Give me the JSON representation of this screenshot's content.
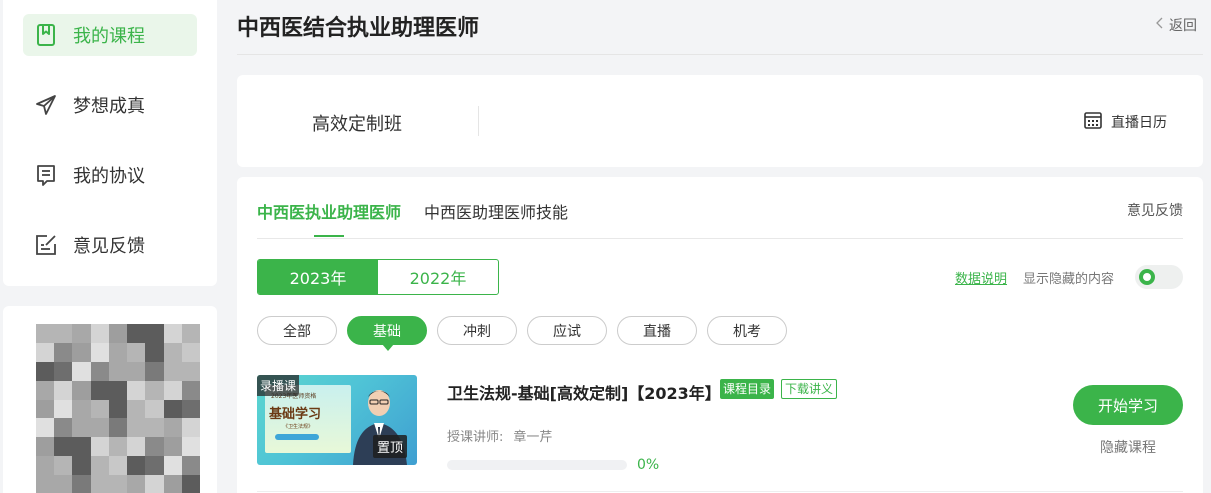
{
  "sidebar": {
    "items": [
      {
        "label": "我的课程",
        "icon": "bookmark-icon",
        "active": true
      },
      {
        "label": "梦想成真",
        "icon": "paper-plane-icon",
        "active": false
      },
      {
        "label": "我的协议",
        "icon": "document-icon",
        "active": false
      },
      {
        "label": "意见反馈",
        "icon": "edit-icon",
        "active": false
      }
    ]
  },
  "header": {
    "title": "中西医结合执业助理医师",
    "back_label": "返回"
  },
  "class_card": {
    "class_name": "高效定制班",
    "calendar_label": "直播日历"
  },
  "tabs": {
    "items": [
      "中西医执业助理医师",
      "中西医助理医师技能"
    ],
    "active_index": 0,
    "feedback_label": "意见反馈"
  },
  "years": {
    "items": [
      "2023年",
      "2022年"
    ],
    "active_index": 0
  },
  "options": {
    "data_desc": "数据说明",
    "show_hidden": "显示隐藏的内容",
    "show_hidden_on": true
  },
  "categories": {
    "items": [
      "全部",
      "基础",
      "冲刺",
      "应试",
      "直播",
      "机考"
    ],
    "active_index": 1
  },
  "course": {
    "thumb_badge": "录播课",
    "thumb_subtitle": "2023年医师资格",
    "thumb_main": "基础学习",
    "thumb_small": "《卫生法规》",
    "thumb_pin": "置顶",
    "title": "卫生法规-基础[高效定制]【2023年】",
    "tag_catalog": "课程目录",
    "tag_download": "下载讲义",
    "teacher_label": "授课讲师:",
    "teacher_name": "章一芹",
    "progress": 0,
    "progress_text": "0%",
    "start_label": "开始学习",
    "hide_label": "隐藏课程"
  },
  "colors": {
    "accent": "#3bb44a",
    "active_bg": "#eaf6ea",
    "page_bg": "#f3f4f6"
  }
}
